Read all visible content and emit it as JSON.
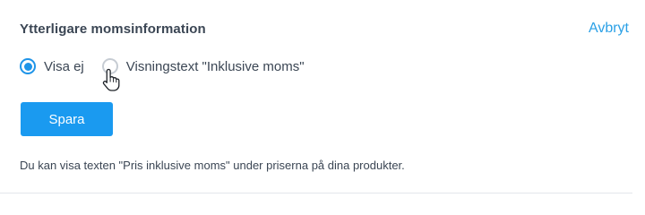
{
  "section": {
    "title": "Ytterligare momsinformation",
    "cancel_label": "Avbryt"
  },
  "radio_options": [
    {
      "label": "Visa ej",
      "checked": true
    },
    {
      "label": "Visningstext \"Inklusive moms\"",
      "checked": false
    }
  ],
  "save_button": {
    "label": "Spara"
  },
  "help_text": "Du kan visa texten \"Pris inklusive moms\" under priserna på dina produkter.",
  "colors": {
    "accent": "#1e94e8",
    "button": "#1a9af0",
    "link": "#2aa0e6",
    "text": "#3b4654"
  },
  "icons": {
    "cursor": "hand-pointer-icon"
  }
}
